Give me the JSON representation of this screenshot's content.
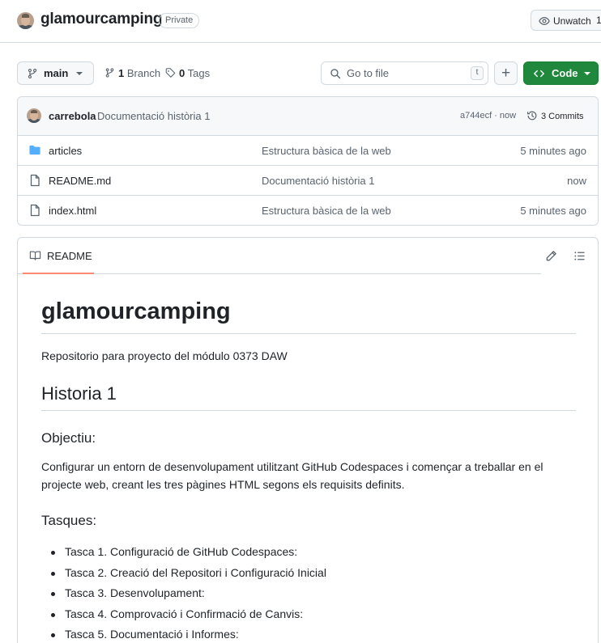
{
  "repo": {
    "name": "glamourcamping",
    "visibility": "Private",
    "watch_label": "Unwatch",
    "watch_count": "1"
  },
  "toolbar": {
    "branch": "main",
    "branches_count": "1",
    "branches_label": "Branch",
    "tags_count": "0",
    "tags_label": "Tags",
    "search_placeholder": "Go to file",
    "search_shortcut": "t",
    "add_label": "+",
    "code_label": "Code"
  },
  "commit": {
    "author": "carrebola",
    "message": "Documentació història 1",
    "hash_time": "a744ecf · now",
    "commits_label": "3 Commits"
  },
  "files": [
    {
      "name": "articles",
      "type": "folder",
      "message": "Estructura bàsica de la web",
      "age": "5 minutes ago"
    },
    {
      "name": "README.md",
      "type": "file",
      "message": "Documentació història 1",
      "age": "now"
    },
    {
      "name": "index.html",
      "type": "file",
      "message": "Estructura bàsica de la web",
      "age": "5 minutes ago"
    }
  ],
  "readme": {
    "tab_label": "README",
    "h1": "glamourcamping",
    "intro": "Repositorio para proyecto del módulo 0373 DAW",
    "h2": "Historia 1",
    "objective_heading": "Objectiu:",
    "objective_text": "Configurar un entorn de desenvolupament utilitzant GitHub Codespaces i començar a treballar en el projecte web, creant les tres pàgines HTML segons els requisits definits.",
    "tasks_heading": "Tasques:",
    "tasks": [
      "Tasca 1. Configuració de GitHub Codespaces:",
      "Tasca 2. Creació del Repositori i Configuració Inicial",
      "Tasca 3. Desenvolupament:",
      "Tasca 4. Comprovació i Confirmació de Canvis:",
      "Tasca 5. Documentació i Informes:"
    ]
  },
  "colors": {
    "accent_green": "#1f883d",
    "folder_blue": "#54aeff",
    "tab_underline": "#fd8c73",
    "border": "#d1d9e0"
  },
  "icons": [
    "eye-icon",
    "git-branch-icon",
    "tag-icon",
    "search-icon",
    "code-icon",
    "history-icon",
    "folder-icon",
    "file-icon",
    "book-icon",
    "pencil-icon",
    "list-unordered-icon"
  ]
}
